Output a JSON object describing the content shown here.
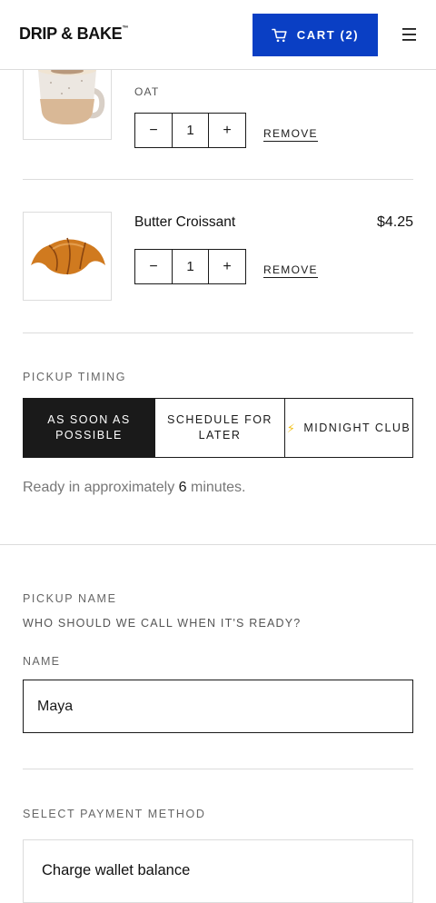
{
  "header": {
    "logo": "DRIP & BAKE",
    "logo_tm": "™",
    "cart_label": "CART (2)",
    "icons": {
      "cart": "cart-icon",
      "menu": "hamburger-menu-icon"
    }
  },
  "cart": {
    "items": [
      {
        "variant": "OAT",
        "quantity": "1",
        "decrement": "−",
        "increment": "+",
        "remove_label": "REMOVE",
        "image": "cappuccino-mug"
      },
      {
        "name": "Butter Croissant",
        "price": "$4.25",
        "quantity": "1",
        "decrement": "−",
        "increment": "+",
        "remove_label": "REMOVE",
        "image": "croissant"
      }
    ]
  },
  "pickup_timing": {
    "label": "PICKUP TIMING",
    "options": [
      {
        "label_line1": "AS SOON AS",
        "label_line2": "POSSIBLE",
        "selected": true
      },
      {
        "label_line1": "SCHEDULE FOR",
        "label_line2": "LATER",
        "selected": false
      },
      {
        "label": "MIDNIGHT CLUB",
        "icon": "lightning-bolt-icon",
        "selected": false
      }
    ],
    "ready_prefix": "Ready in approximately",
    "ready_minutes": "6",
    "ready_suffix": "minutes."
  },
  "pickup_name": {
    "label": "PICKUP NAME",
    "subtitle": "WHO SHOULD WE CALL WHEN IT'S READY?",
    "field_label": "NAME",
    "value": "Maya"
  },
  "payment": {
    "label": "SELECT PAYMENT METHOD",
    "option": "Charge wallet balance"
  },
  "colors": {
    "accent": "#0a3fc4",
    "selected_bg": "#1a1a1a",
    "bolt": "#f3c21b"
  }
}
